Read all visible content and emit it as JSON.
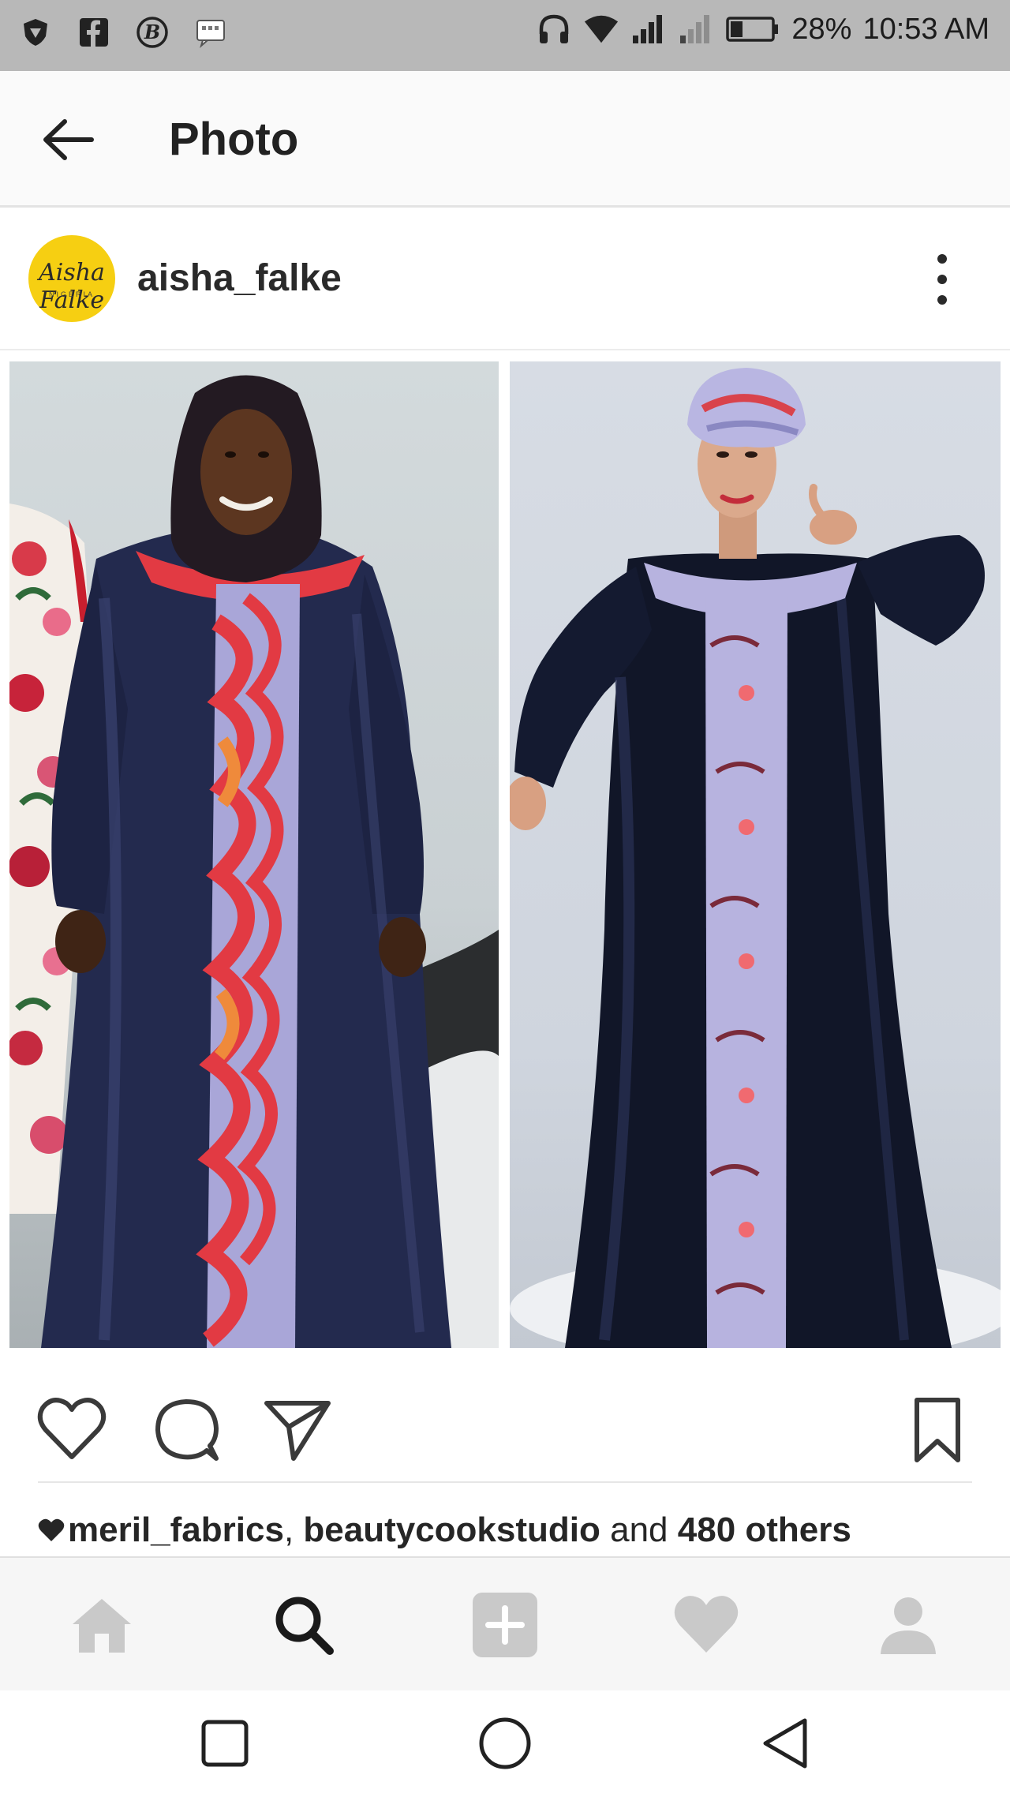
{
  "status_bar": {
    "battery": "28%",
    "time": "10:53 AM"
  },
  "app_bar": {
    "title": "Photo"
  },
  "post": {
    "username": "aisha_falke",
    "avatar_logo": "Aisha Falke",
    "avatar_logo_sub": "NIGERIA"
  },
  "likes": {
    "user1": "meril_fabrics",
    "separator": ", ",
    "user2": "beautycookstudio",
    "and": " and ",
    "others": "480 others"
  },
  "colors": {
    "status_bar_bg": "#b8b8b8",
    "avatar_bg": "#f6cf12",
    "dress_navy": "#232a4e",
    "panel_red": "#e23a43",
    "panel_lilac": "#a9a6d8",
    "inactive_nav_icon": "#c9c9c9"
  },
  "icons": {
    "status_left": [
      "shield-icon",
      "facebook-icon",
      "bbm-icon",
      "chat-icon"
    ],
    "status_right": [
      "headphones-icon",
      "wifi-icon",
      "signal-icon",
      "signal-weak-icon",
      "battery-icon"
    ],
    "actions": [
      "heart-icon",
      "comment-icon",
      "share-icon",
      "bookmark-icon"
    ],
    "bottom_nav": [
      "home-icon",
      "search-icon",
      "add-icon",
      "activity-heart-icon",
      "profile-icon"
    ],
    "system_nav": [
      "recents-icon",
      "home-circle-icon",
      "back-triangle-icon"
    ]
  }
}
